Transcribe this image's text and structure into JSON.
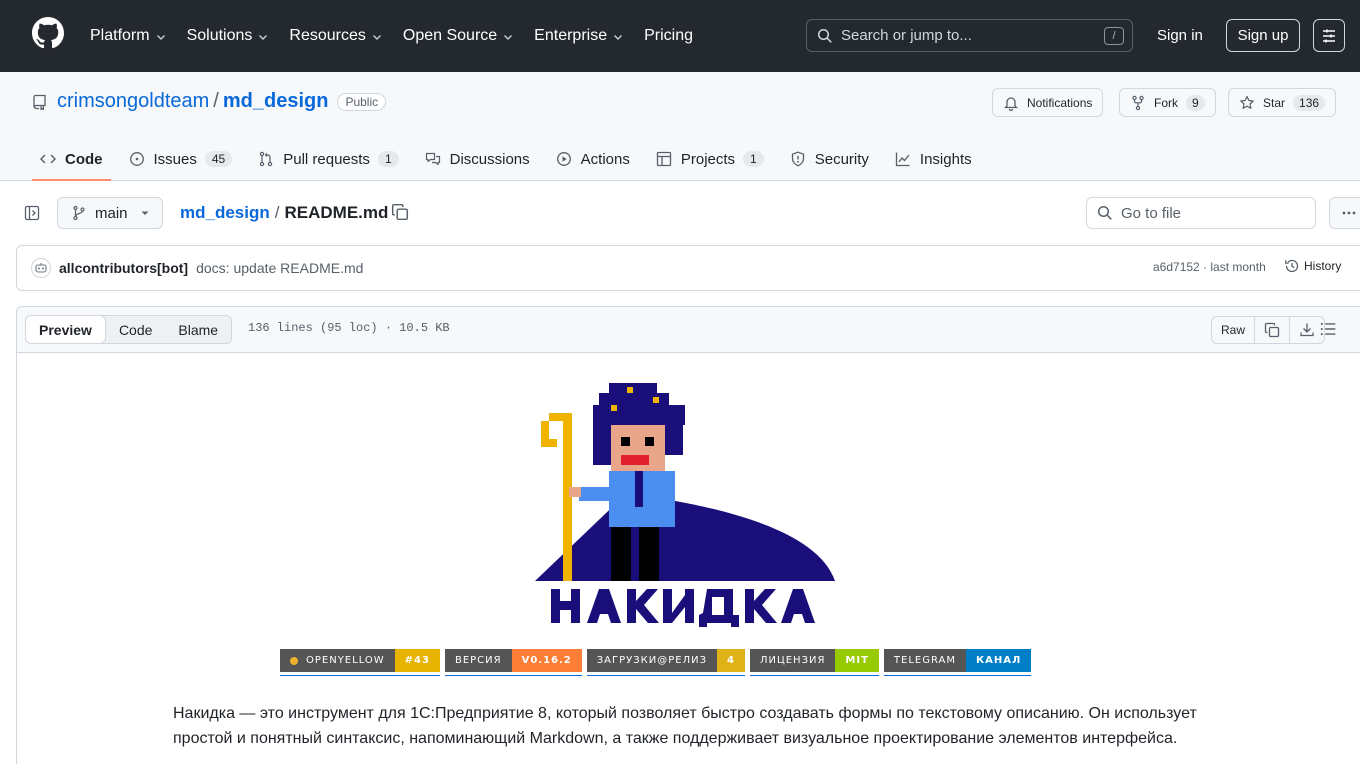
{
  "header": {
    "nav": [
      {
        "label": "Platform",
        "dropdown": true
      },
      {
        "label": "Solutions",
        "dropdown": true
      },
      {
        "label": "Resources",
        "dropdown": true
      },
      {
        "label": "Open Source",
        "dropdown": true
      },
      {
        "label": "Enterprise",
        "dropdown": true
      },
      {
        "label": "Pricing",
        "dropdown": false
      }
    ],
    "search_placeholder": "Search or jump to...",
    "search_shortcut": "/",
    "sign_in": "Sign in",
    "sign_up": "Sign up"
  },
  "repo": {
    "owner": "crimsongoldteam",
    "separator": "/",
    "name": "md_design",
    "visibility": "Public",
    "notifications_label": "Notifications",
    "fork_label": "Fork",
    "fork_count": "9",
    "star_label": "Star",
    "star_count": "136",
    "tabs": [
      {
        "label": "Code",
        "count": ""
      },
      {
        "label": "Issues",
        "count": "45"
      },
      {
        "label": "Pull requests",
        "count": "1"
      },
      {
        "label": "Discussions",
        "count": ""
      },
      {
        "label": "Actions",
        "count": ""
      },
      {
        "label": "Projects",
        "count": "1"
      },
      {
        "label": "Security",
        "count": ""
      },
      {
        "label": "Insights",
        "count": ""
      }
    ]
  },
  "file_nav": {
    "branch": "main",
    "breadcrumb_repo": "md_design",
    "breadcrumb_sep": "/",
    "file_name": "README.md",
    "goto_placeholder": "Go to file"
  },
  "commit": {
    "author": "allcontributors[bot]",
    "message": "docs: update README.md",
    "meta": "a6d7152 · last month",
    "history": "History"
  },
  "file_view": {
    "tabs": [
      "Preview",
      "Code",
      "Blame"
    ],
    "info": "136 lines (95 loc) · 10.5 KB",
    "raw": "Raw"
  },
  "readme": {
    "badges": [
      {
        "label": "OPENYELLOW",
        "value": "#43",
        "color": "#e6b400",
        "icon": "openyellow-dot"
      },
      {
        "label": "ВЕРСИЯ",
        "value": "V0.16.2",
        "color": "#fe7d37",
        "icon": ""
      },
      {
        "label": "ЗАГРУЗКИ@РЕЛИЗ",
        "value": "4",
        "color": "#dfb317",
        "icon": ""
      },
      {
        "label": "ЛИЦЕНЗИЯ",
        "value": "MIT",
        "color": "#97ca00",
        "icon": ""
      },
      {
        "label": "TELEGRAM",
        "value": "КАНАЛ",
        "color": "#007ec6",
        "icon": ""
      }
    ],
    "intro": "Накидка — это инструмент для 1С:Предприятие 8, который позволяет быстро создавать формы по текстовому описанию. Он использует простой и понятный синтаксис, напоминающий Markdown, а также поддерживает визуальное проектирование элементов интерфейса."
  },
  "colors": {
    "header_bg": "#24292f",
    "link": "#0969da",
    "active_tab_underline": "#fd8c73",
    "logo_navy": "#1a0f7a",
    "logo_staff": "#f0b400",
    "logo_shirt": "#4a8ff0"
  }
}
